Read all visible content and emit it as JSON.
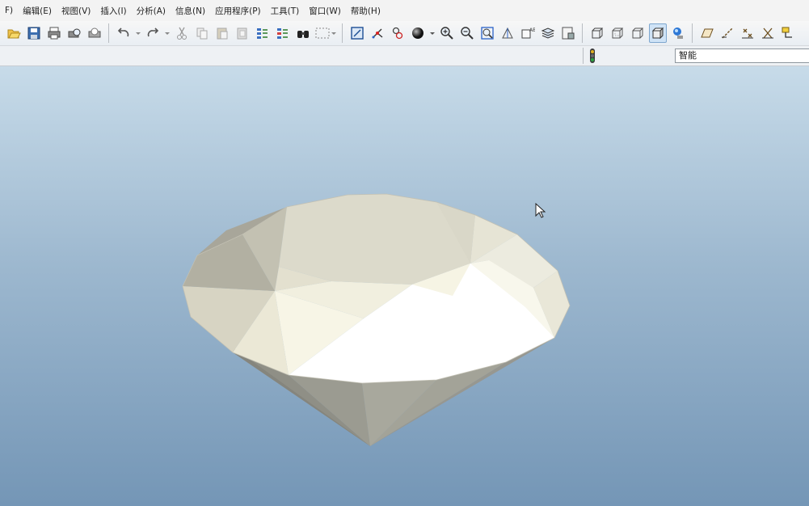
{
  "menu": {
    "file": "F)",
    "edit": "编辑(E)",
    "view": "视图(V)",
    "insert": "插入(I)",
    "analysis": "分析(A)",
    "info": "信息(N)",
    "apps": "应用程序(P)",
    "tools": "工具(T)",
    "window": "窗口(W)",
    "help": "帮助(H)"
  },
  "toolbar": {
    "icons": [
      "open-icon",
      "save-icon",
      "print-icon",
      "print-preview-icon",
      "quick-print-icon",
      "undo-icon",
      "redo-icon",
      "cut-icon",
      "copy-icon",
      "paste-icon",
      "paste-special-icon",
      "regenerate-icon",
      "regenerate-manager-icon",
      "find-icon",
      "select-box-icon",
      "repaint-icon",
      "spin-center-icon",
      "orient-mode-icon",
      "appearance-icon",
      "zoom-in-icon",
      "zoom-out-icon",
      "refit-icon",
      "reorient-icon",
      "saved-views-icon",
      "layers-icon",
      "model-setup-icon",
      "wireframe-icon",
      "hidden-line-icon",
      "no-hidden-icon",
      "shading-icon",
      "enhanced-realism-icon",
      "datum-plane-icon",
      "datum-axis-icon",
      "datum-point-icon",
      "coordinate-system-icon",
      "annotation-icon"
    ],
    "active_icon": "shading-icon"
  },
  "status": {
    "filter_value": "智能"
  },
  "model": {
    "name": "diamond-model",
    "colors": {
      "bright": "#ffffff",
      "light": "#f4f2e4",
      "mid": "#dad8c8",
      "shadow": "#a3a294",
      "dark": "#8a8a80"
    }
  }
}
